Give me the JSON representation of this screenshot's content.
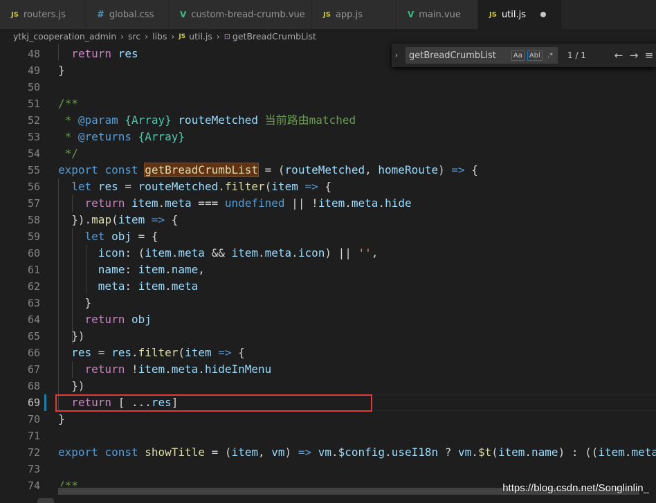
{
  "tabs": [
    {
      "icon": "JS",
      "kind": "js",
      "label": "routers.js"
    },
    {
      "icon": "#",
      "kind": "css",
      "label": "global.css"
    },
    {
      "icon": "V",
      "kind": "vue",
      "label": "custom-bread-crumb.vue"
    },
    {
      "icon": "JS",
      "kind": "js",
      "label": "app.js"
    },
    {
      "icon": "V",
      "kind": "vue",
      "label": "main.vue"
    },
    {
      "icon": "JS",
      "kind": "js",
      "label": "util.js"
    }
  ],
  "breadcrumb": {
    "root": "ytkj_cooperation_admin",
    "dir1": "src",
    "dir2": "libs",
    "file_icon": "JS",
    "file": "util.js",
    "symbol": "getBreadCrumbList"
  },
  "find_widget": {
    "query": "getBreadCrumbList",
    "match_case": "Aa",
    "whole_word": "Abl",
    "regex": ".*",
    "result_count": "1 / 1"
  },
  "line_numbers": [
    "48",
    "49",
    "50",
    "51",
    "52",
    "53",
    "54",
    "55",
    "56",
    "57",
    "58",
    "59",
    "60",
    "61",
    "62",
    "63",
    "64",
    "65",
    "66",
    "67",
    "68",
    "69",
    "70",
    "71",
    "72",
    "73",
    "74"
  ],
  "code": {
    "l48": "return res",
    "l52_cn": "当前路由matched",
    "hl": "getBreadCrumbList"
  },
  "watermark": "https://blog.csdn.net/Songlinlin_"
}
